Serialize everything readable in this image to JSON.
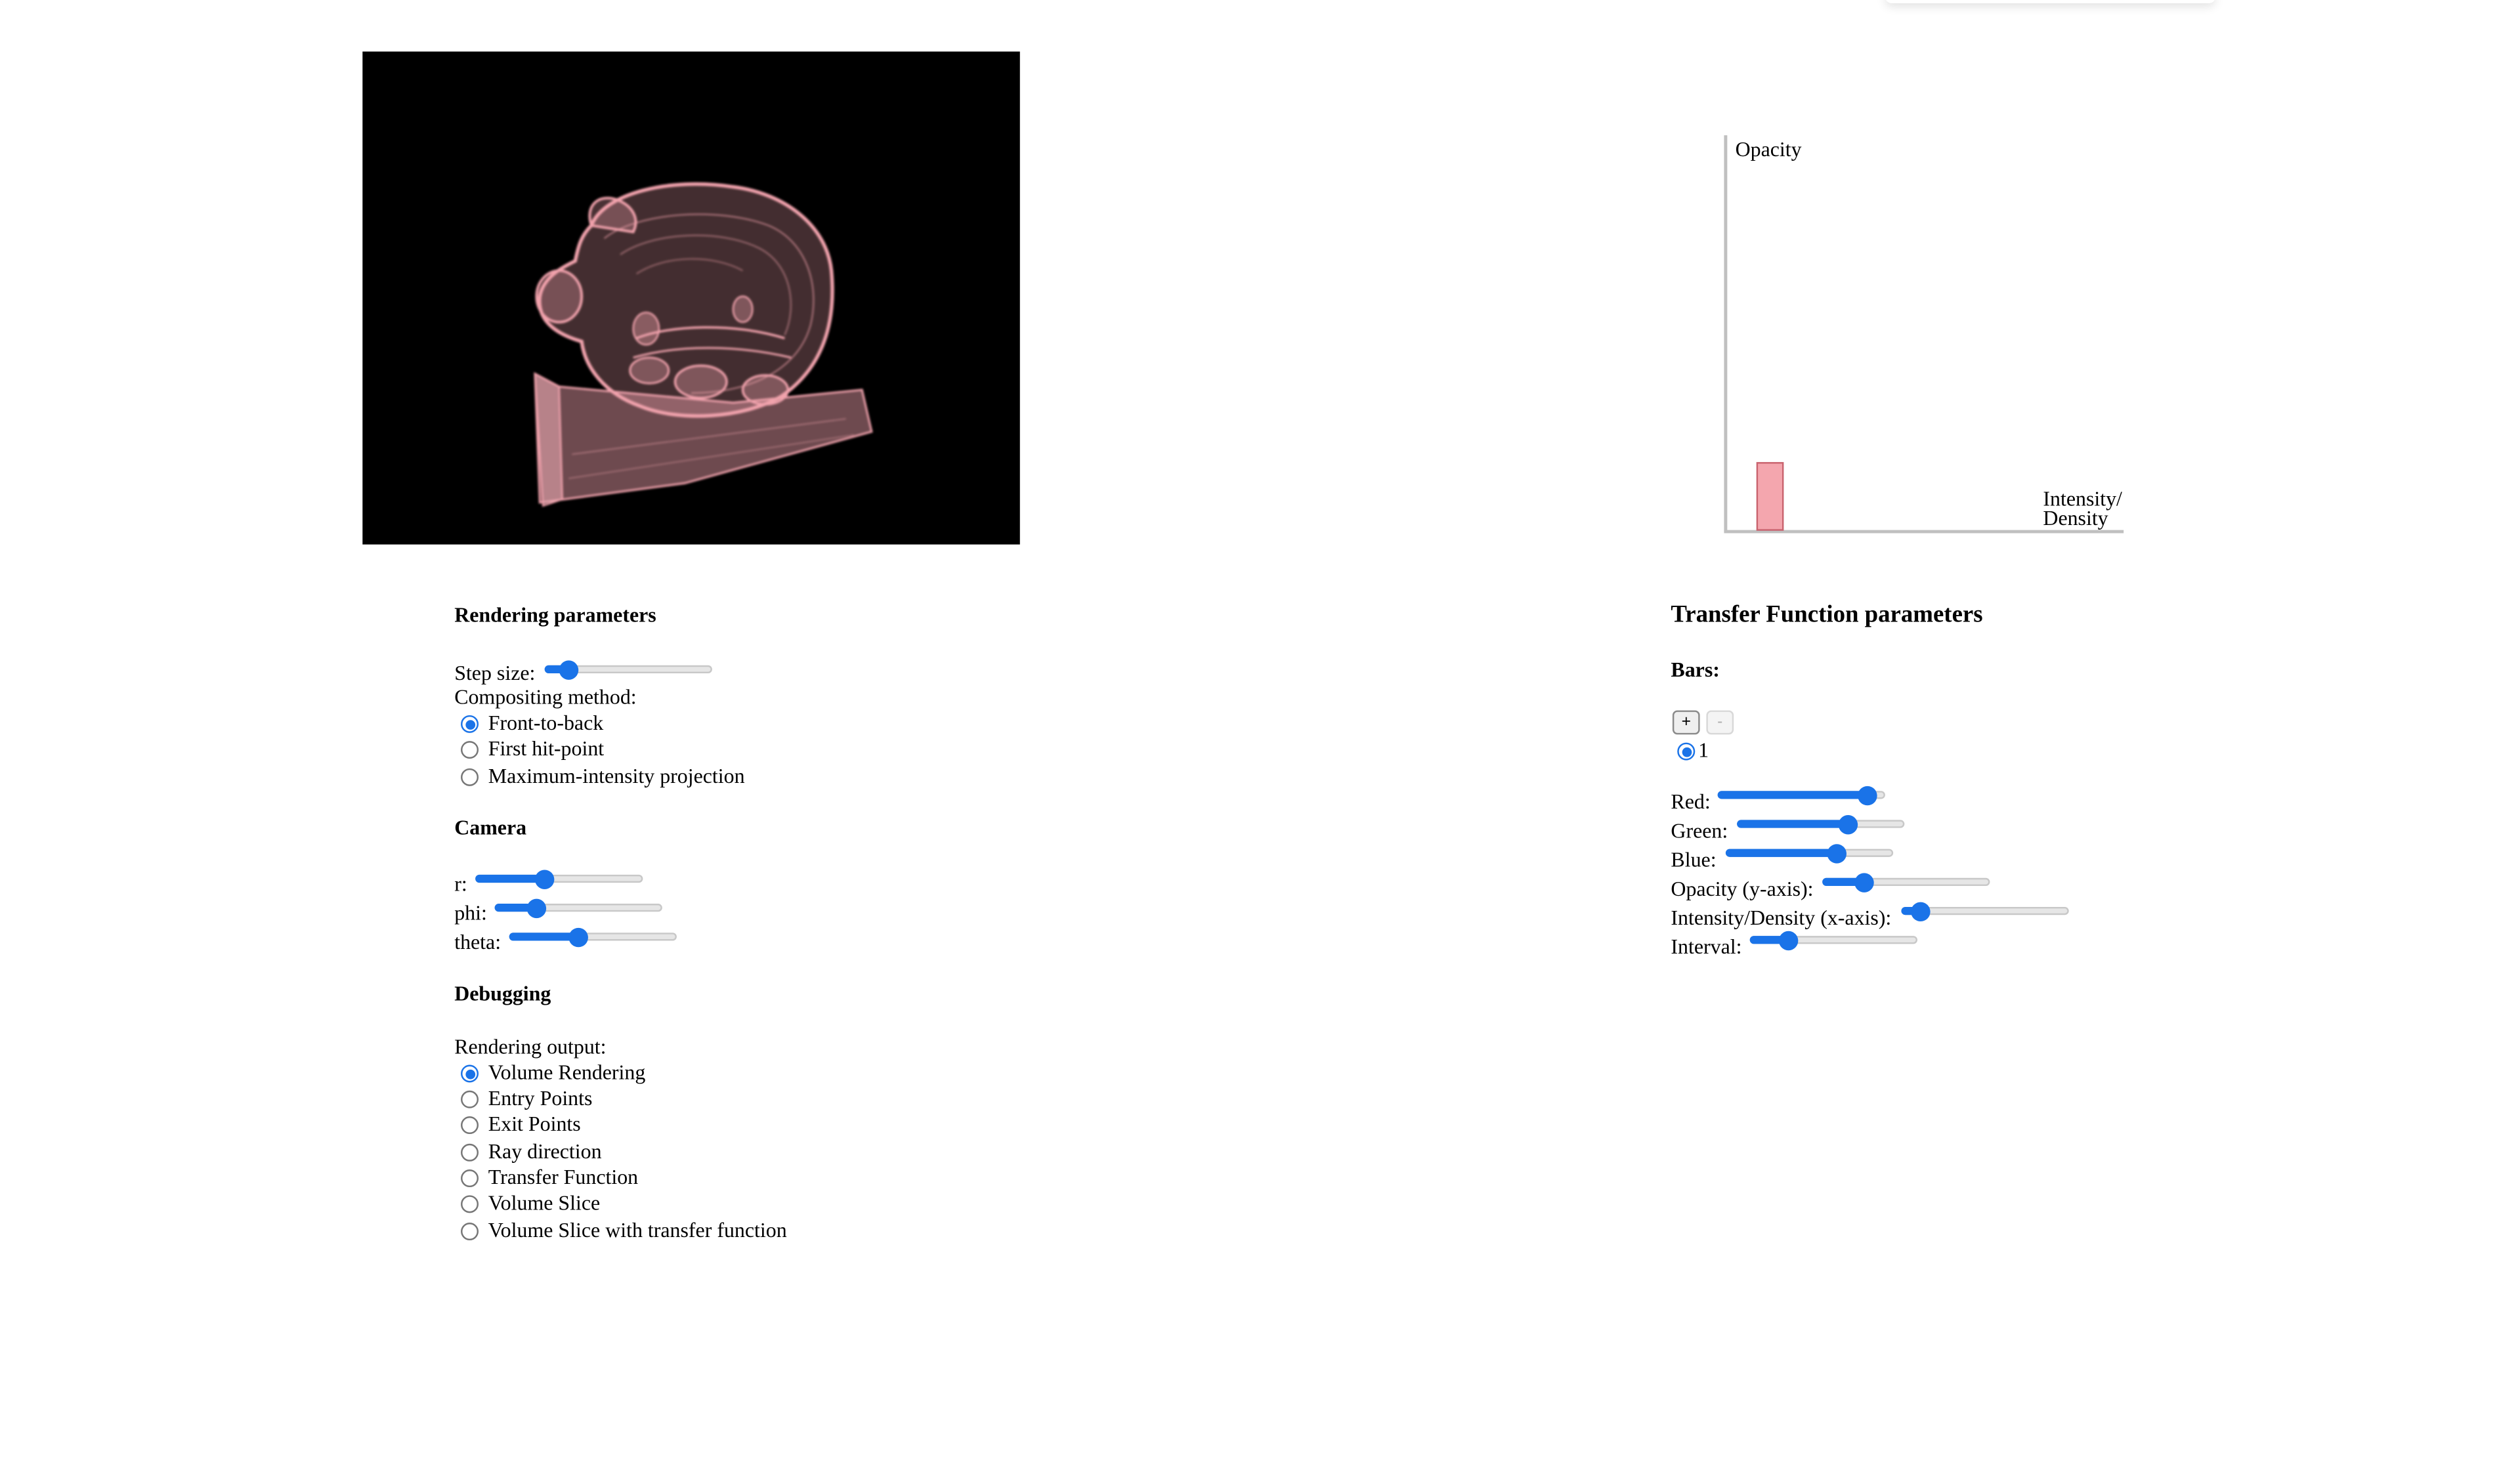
{
  "colors": {
    "accent": "#1a73e8",
    "bar_fill": "#f4a6ae",
    "bar_stroke": "#c9636e",
    "render_bg": "#000000",
    "volume_tint": "#f2a3ad"
  },
  "render_view": {
    "content": "pink translucent piggy-bank volume rendering on black background"
  },
  "tf_chart": {
    "y_label": "Opacity",
    "x_label_line1": "Intensity/",
    "x_label_line2": "Density"
  },
  "chart_data": {
    "type": "bar",
    "title": "",
    "ylabel": "Opacity",
    "xlabel": "Intensity/ Density",
    "bars": [
      {
        "label": "1",
        "opacity": 0.17,
        "density": 0.06,
        "color": "#f4a6ae"
      }
    ],
    "xlim": [
      0,
      1
    ],
    "ylim": [
      0,
      1
    ]
  },
  "rendering": {
    "heading": "Rendering parameters",
    "step_size_label": "Step size:",
    "step_size_value": 0.1,
    "compositing_label": "Compositing method:",
    "compositing_options": [
      "Front-to-back",
      "First hit-point",
      "Maximum-intensity projection"
    ],
    "compositing_selected": 0
  },
  "camera": {
    "heading": "Camera",
    "r_label": "r:",
    "r_value": 0.4,
    "phi_label": "phi:",
    "phi_value": 0.22,
    "theta_label": "theta:",
    "theta_value": 0.4
  },
  "debugging": {
    "heading": "Debugging",
    "output_label": "Rendering output:",
    "options": [
      "Volume Rendering",
      "Entry Points",
      "Exit Points",
      "Ray direction",
      "Transfer Function",
      "Volume Slice",
      "Volume Slice with transfer function"
    ],
    "selected": 0
  },
  "tf": {
    "heading": "Transfer Function parameters",
    "bars_heading": "Bars:",
    "add_label": "+",
    "remove_label": "-",
    "bar_item_label": "1",
    "red_label": "Red:",
    "red_value": 0.95,
    "green_label": "Green:",
    "green_value": 0.68,
    "blue_label": "Blue:",
    "blue_value": 0.68,
    "opacity_label": "Opacity (y-axis):",
    "opacity_value": 0.22,
    "density_label": "Intensity/Density (x-axis):",
    "density_value": 0.06,
    "interval_label": "Interval:",
    "interval_value": 0.2
  }
}
